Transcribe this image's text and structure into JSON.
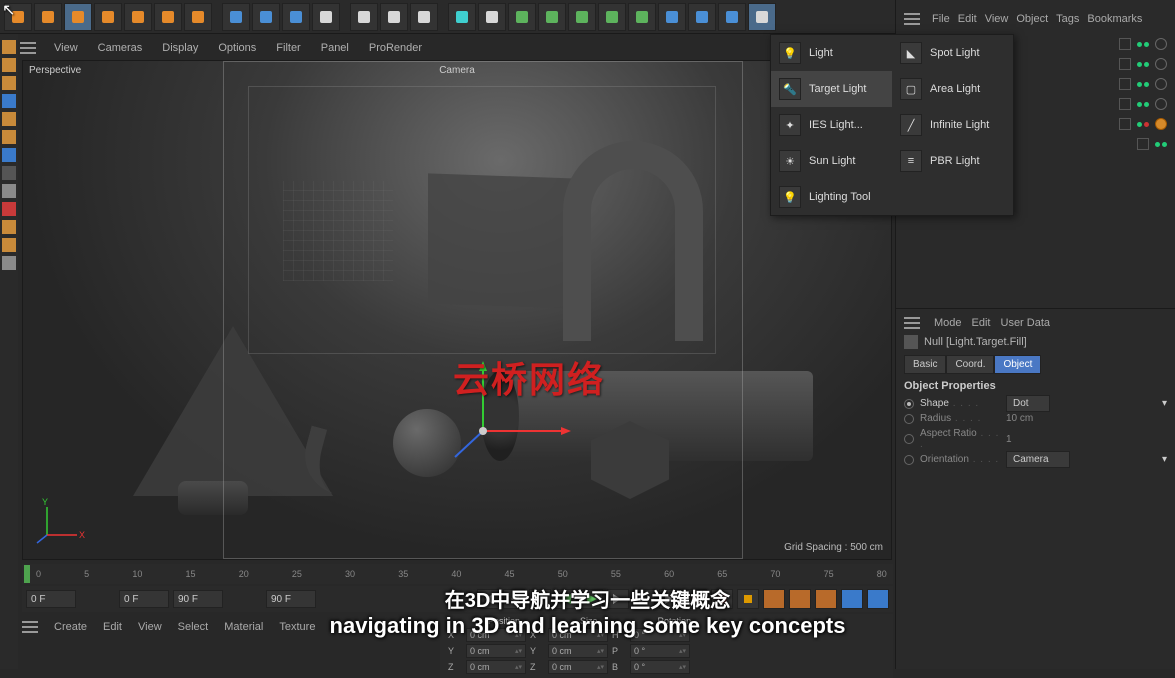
{
  "viewport": {
    "menu": [
      "View",
      "Cameras",
      "Display",
      "Options",
      "Filter",
      "Panel",
      "ProRender"
    ],
    "label": "Perspective",
    "camera_label": "Camera",
    "grid_spacing": "Grid Spacing : 500 cm",
    "watermark": "云桥网络"
  },
  "light_flyout": {
    "col1": [
      {
        "label": "Light",
        "hover": false
      },
      {
        "label": "Target Light",
        "hover": true
      },
      {
        "label": "IES Light...",
        "hover": false
      },
      {
        "label": "Sun Light",
        "hover": false
      },
      {
        "label": "Lighting Tool",
        "hover": false
      }
    ],
    "col2": [
      {
        "label": "Spot Light"
      },
      {
        "label": "Area Light"
      },
      {
        "label": "Infinite Light"
      },
      {
        "label": "PBR Light"
      }
    ]
  },
  "right_menu": [
    "File",
    "Edit",
    "View",
    "Object",
    "Tags",
    "Bookmarks"
  ],
  "attr": {
    "menu": [
      "Mode",
      "Edit",
      "User Data"
    ],
    "object_name": "Null [Light.Target.Fill]",
    "tabs": [
      {
        "label": "Basic",
        "active": false
      },
      {
        "label": "Coord.",
        "active": false
      },
      {
        "label": "Object",
        "active": true
      }
    ],
    "section_title": "Object Properties",
    "rows": [
      {
        "label": "Shape",
        "value": "Dot",
        "active": true,
        "type": "select"
      },
      {
        "label": "Radius",
        "value": "10 cm",
        "active": false,
        "type": "text"
      },
      {
        "label": "Aspect Ratio",
        "value": "1",
        "active": false,
        "type": "text"
      },
      {
        "label": "Orientation",
        "value": "Camera",
        "active": false,
        "type": "select"
      }
    ]
  },
  "timeline": {
    "ticks": [
      "0",
      "5",
      "10",
      "15",
      "20",
      "25",
      "30",
      "35",
      "40",
      "45",
      "50",
      "55",
      "60",
      "65",
      "70",
      "75",
      "80"
    ],
    "fields": [
      "0 F",
      "0 F",
      "90 F",
      "90 F"
    ]
  },
  "bottom_menu": [
    "Create",
    "Edit",
    "View",
    "Select",
    "Material",
    "Texture"
  ],
  "coord": {
    "headers": [
      "Position",
      "Size",
      "Rotation"
    ],
    "rows": [
      {
        "axis": "X",
        "p": "0 cm",
        "s": "0 cm",
        "r": "0 °",
        "rl": "H"
      },
      {
        "axis": "Y",
        "p": "0 cm",
        "s": "0 cm",
        "r": "0 °",
        "rl": "P"
      },
      {
        "axis": "Z",
        "p": "0 cm",
        "s": "0 cm",
        "r": "0 °",
        "rl": "B"
      }
    ]
  },
  "subtitles": {
    "cn": "在3D中导航并学习一些关键概念",
    "en": "navigating in 3D and learning some key concepts"
  },
  "toolbar_icons": [
    {
      "name": "undo",
      "color": "orange"
    },
    {
      "name": "redo",
      "color": "orange"
    },
    {
      "name": "select-live",
      "color": "orange",
      "hl": true
    },
    {
      "name": "move",
      "color": "orange"
    },
    {
      "name": "scale",
      "color": "orange"
    },
    {
      "name": "rotate",
      "color": "orange"
    },
    {
      "name": "last-tool",
      "color": "orange"
    },
    {
      "name": "sep"
    },
    {
      "name": "x-axis",
      "color": "blue"
    },
    {
      "name": "y-axis",
      "color": "blue"
    },
    {
      "name": "z-axis",
      "color": "blue"
    },
    {
      "name": "coord-sys",
      "color": "white"
    },
    {
      "name": "sep"
    },
    {
      "name": "render-view",
      "color": "white"
    },
    {
      "name": "render-pict",
      "color": "white"
    },
    {
      "name": "render-settings",
      "color": "white"
    },
    {
      "name": "sep"
    },
    {
      "name": "primitive",
      "color": "teal"
    },
    {
      "name": "spline-pen",
      "color": "white"
    },
    {
      "name": "generator",
      "color": "green"
    },
    {
      "name": "generator2",
      "color": "green"
    },
    {
      "name": "subdiv",
      "color": "green"
    },
    {
      "name": "array",
      "color": "green"
    },
    {
      "name": "instance",
      "color": "green"
    },
    {
      "name": "deform",
      "color": "blue"
    },
    {
      "name": "env",
      "color": "blue"
    },
    {
      "name": "camera",
      "color": "blue"
    },
    {
      "name": "light",
      "color": "white",
      "hl": true
    }
  ]
}
